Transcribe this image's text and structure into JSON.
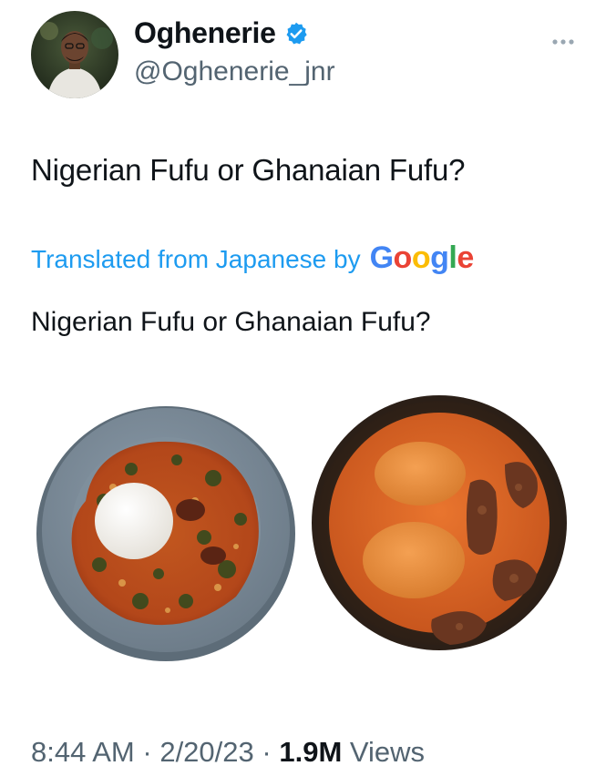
{
  "author": {
    "display_name": "Oghenerie",
    "handle": "@Oghenerie_jnr",
    "verified": true
  },
  "tweet": {
    "text": "Nigerian Fufu or Ghanaian Fufu?",
    "translation_label": "Translated from Japanese by",
    "translation_provider": "Google",
    "translated_text": "Nigerian Fufu or Ghanaian Fufu?"
  },
  "meta": {
    "time": "8:44 AM",
    "separator": "·",
    "date": "2/20/23",
    "views_count": "1.9M",
    "views_label": "Views"
  },
  "icons": {
    "more": "more-icon",
    "verified": "verified-badge-icon"
  },
  "colors": {
    "link_blue": "#1d9bf0",
    "secondary_text": "#536471",
    "verified_blue": "#1d9bf0"
  }
}
